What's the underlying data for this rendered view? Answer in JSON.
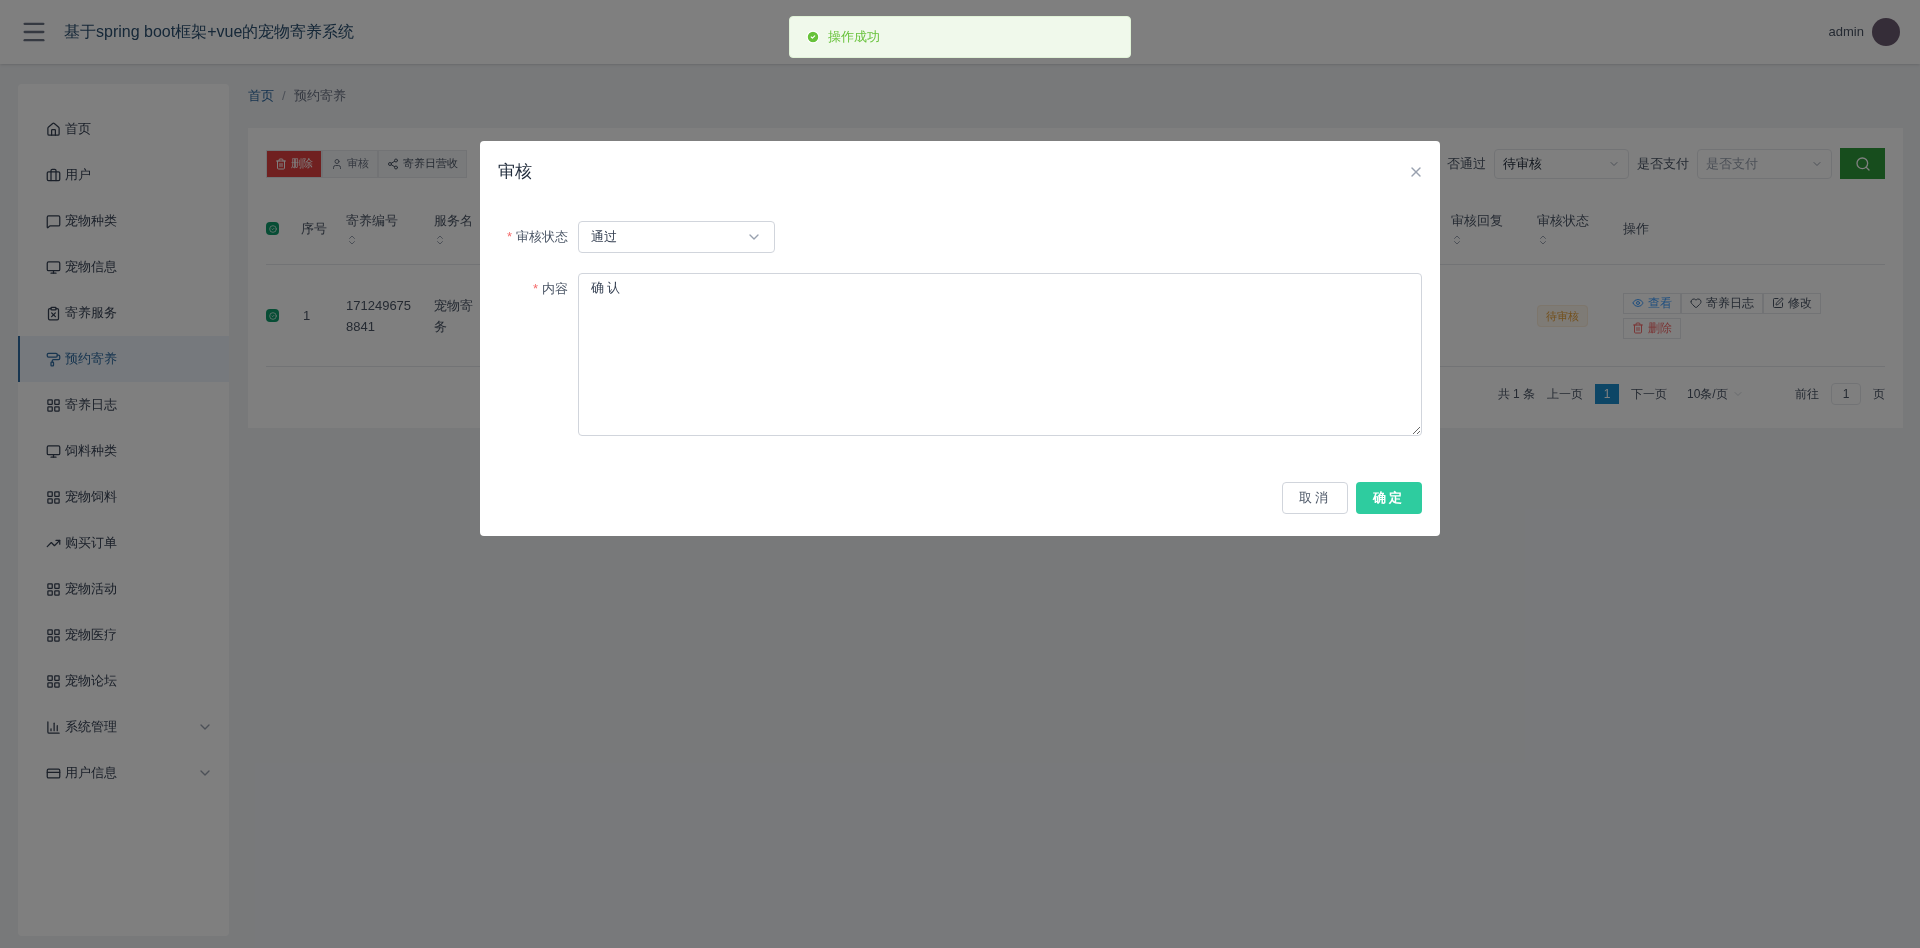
{
  "header": {
    "title": "基于spring boot框架+vue的宠物寄养系统",
    "user": "admin"
  },
  "toast": {
    "text": "操作成功"
  },
  "sidebar": {
    "items": [
      {
        "label": "首页",
        "selected": false,
        "expandable": false
      },
      {
        "label": "用户",
        "selected": false,
        "expandable": false
      },
      {
        "label": "宠物种类",
        "selected": false,
        "expandable": false
      },
      {
        "label": "宠物信息",
        "selected": false,
        "expandable": false
      },
      {
        "label": "寄养服务",
        "selected": false,
        "expandable": false
      },
      {
        "label": "预约寄养",
        "selected": true,
        "expandable": false
      },
      {
        "label": "寄养日志",
        "selected": false,
        "expandable": false
      },
      {
        "label": "饲料种类",
        "selected": false,
        "expandable": false
      },
      {
        "label": "宠物饲料",
        "selected": false,
        "expandable": false
      },
      {
        "label": "购买订单",
        "selected": false,
        "expandable": false
      },
      {
        "label": "宠物活动",
        "selected": false,
        "expandable": false
      },
      {
        "label": "宠物医疗",
        "selected": false,
        "expandable": false
      },
      {
        "label": "宠物论坛",
        "selected": false,
        "expandable": false
      },
      {
        "label": "系统管理",
        "selected": false,
        "expandable": true
      },
      {
        "label": "用户信息",
        "selected": false,
        "expandable": true
      }
    ]
  },
  "breadcrumb": {
    "items": [
      "首页",
      "预约寄养"
    ],
    "separator": "/"
  },
  "toolbar": [
    {
      "label": "删除",
      "kind": "danger"
    },
    {
      "label": "审核",
      "kind": "audit"
    },
    {
      "label": "寄养日营收",
      "kind": "share"
    }
  ],
  "filters": [
    {
      "label": "否通过",
      "value": "待审核"
    },
    {
      "label": "是否支付",
      "placeholder": "是否支付"
    }
  ],
  "table": {
    "all_checked": true,
    "columns_left": [
      {
        "label": "序号",
        "sortable": false
      },
      {
        "label": "寄养编号",
        "sortable": true
      },
      {
        "label": "服务名",
        "sortable": true
      }
    ],
    "columns_right": [
      {
        "label": "审核回复",
        "sortable": true
      },
      {
        "label": "审核状态",
        "sortable": true
      },
      {
        "label": "操作",
        "sortable": false
      }
    ],
    "rows": [
      {
        "checked": true,
        "index": "1",
        "code": [
          "171249675",
          "8841"
        ],
        "service": [
          "宠物寄",
          "务"
        ],
        "status": "待审核",
        "actions": [
          {
            "label": "查看",
            "kind": "view"
          },
          {
            "label": "寄养日志",
            "kind": "log"
          },
          {
            "label": "修改",
            "kind": "edit"
          },
          {
            "label": "删除",
            "kind": "delete"
          }
        ]
      }
    ]
  },
  "pagination": {
    "total": "共 1 条",
    "prev": "上一页",
    "pages": [
      {
        "label": "1",
        "selected": true
      }
    ],
    "next": "下一页",
    "size": "10条/页",
    "goto": "前往",
    "page": "1",
    "suffix": "页"
  },
  "modal": {
    "title": "审核",
    "required_mark": "*",
    "fields": [
      {
        "label": "审核状态",
        "required": true,
        "kind": "select",
        "value": "通过"
      },
      {
        "label": "内容",
        "required": true,
        "kind": "textarea",
        "value": "确认"
      }
    ],
    "buttons": [
      {
        "label": "取消",
        "kind": "default"
      },
      {
        "label": "确定",
        "kind": "primary"
      }
    ]
  }
}
